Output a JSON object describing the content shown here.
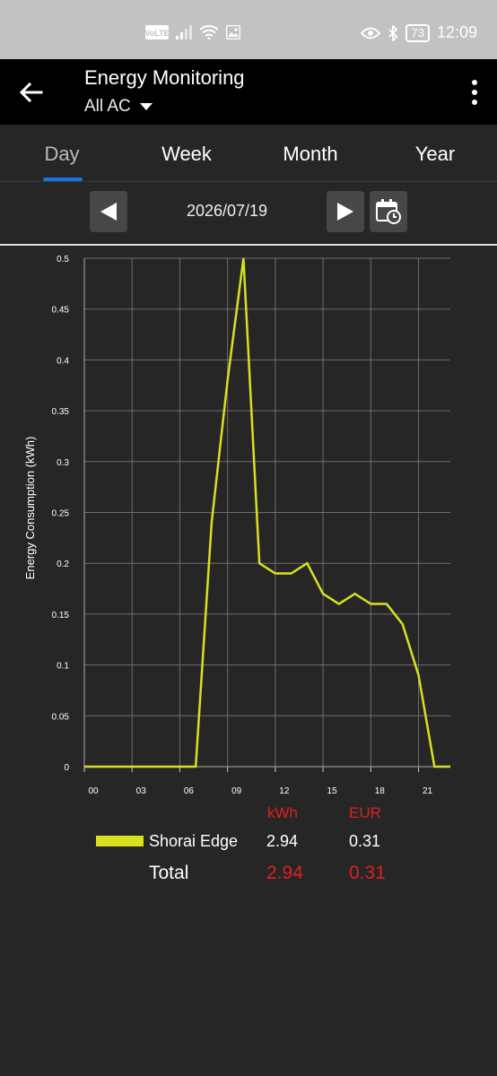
{
  "status_bar": {
    "time": "12:09",
    "battery": "73",
    "volte_label": "VoLTE"
  },
  "app_bar": {
    "title": "Energy Monitoring",
    "subtitle": "All AC"
  },
  "tabs": [
    {
      "label": "Day",
      "active": true
    },
    {
      "label": "Week",
      "active": false
    },
    {
      "label": "Month",
      "active": false
    },
    {
      "label": "Year",
      "active": false
    }
  ],
  "date_nav": {
    "date": "2026/07/19"
  },
  "colors": {
    "accent_tab": "#1a73e8",
    "series": "#d8e020",
    "header_red": "#e0201f",
    "grid": "#6e6e6e"
  },
  "chart_data": {
    "type": "line",
    "ylabel": "Energy Consumption (kWh)",
    "xlabel": "",
    "ylim": [
      0,
      0.5
    ],
    "xlim": [
      0,
      23
    ],
    "y_ticks": [
      "0",
      "0.05",
      "0.1",
      "0.15",
      "0.2",
      "0.25",
      "0.3",
      "0.35",
      "0.4",
      "0.45",
      "0.5"
    ],
    "x_ticks": [
      "00",
      "03",
      "06",
      "09",
      "12",
      "15",
      "18",
      "21"
    ],
    "grid": true,
    "series": [
      {
        "name": "Shorai Edge",
        "x": [
          0,
          1,
          2,
          3,
          4,
          5,
          6,
          7,
          8,
          9,
          10,
          11,
          12,
          13,
          14,
          15,
          16,
          17,
          18,
          19,
          20,
          21,
          22,
          23
        ],
        "values": [
          0,
          0,
          0,
          0,
          0,
          0,
          0,
          0,
          0.24,
          0.38,
          0.5,
          0.2,
          0.19,
          0.19,
          0.2,
          0.17,
          0.16,
          0.17,
          0.16,
          0.16,
          0.14,
          0.09,
          0,
          0
        ]
      }
    ]
  },
  "legend": {
    "headers": {
      "kwh": "kWh",
      "eur": "EUR"
    },
    "rows": [
      {
        "name": "Shorai Edge",
        "kwh": "2.94",
        "eur": "0.31"
      }
    ],
    "total": {
      "label": "Total",
      "kwh": "2.94",
      "eur": "0.31"
    }
  }
}
